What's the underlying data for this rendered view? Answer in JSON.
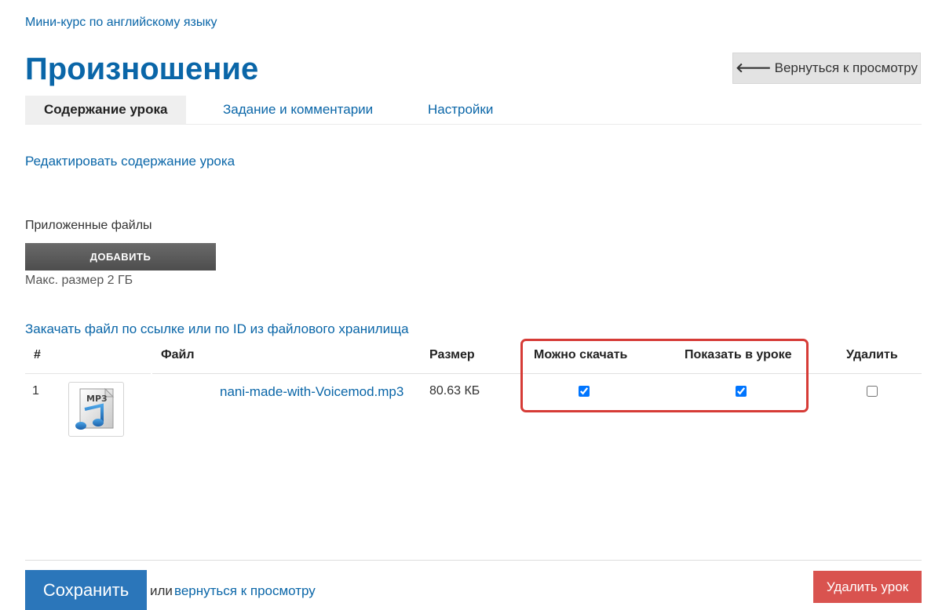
{
  "breadcrumb": {
    "course": "Мини-курс по английскому языку"
  },
  "page": {
    "title": "Произношение",
    "back_button": "Вернуться к просмотру"
  },
  "tabs": [
    {
      "label": "Содержание урока",
      "active": true
    },
    {
      "label": "Задание и комментарии",
      "active": false
    },
    {
      "label": "Настройки",
      "active": false
    }
  ],
  "content": {
    "edit_link": "Редактировать содержание урока",
    "files_label": "Приложенные файлы",
    "add_button": "ДОБАВИТЬ",
    "max_size": "Макс. размер 2 ГБ",
    "upload_link": "Закачать файл по ссылке или по ID из файлового хранилища"
  },
  "table": {
    "columns": [
      "#",
      "Файл",
      "Размер",
      "Можно скачать",
      "Показать в уроке",
      "Удалить"
    ],
    "rows": [
      {
        "num": "1",
        "thumb_icon": "mp3-file-icon",
        "file_name": "nani-made-with-Voicemod.mp3",
        "size": "80.63 КБ",
        "can_download": true,
        "show_in_lesson": true,
        "delete": false
      }
    ]
  },
  "footer": {
    "save_button": "Сохранить",
    "or_text": "или",
    "return_link": "вернуться к просмотру",
    "delete_button": "Удалить урок"
  },
  "colors": {
    "link": "#0a66a8",
    "primary_button": "#2b76ba",
    "danger_button": "#d9534f",
    "highlight_box": "#d63b36"
  }
}
